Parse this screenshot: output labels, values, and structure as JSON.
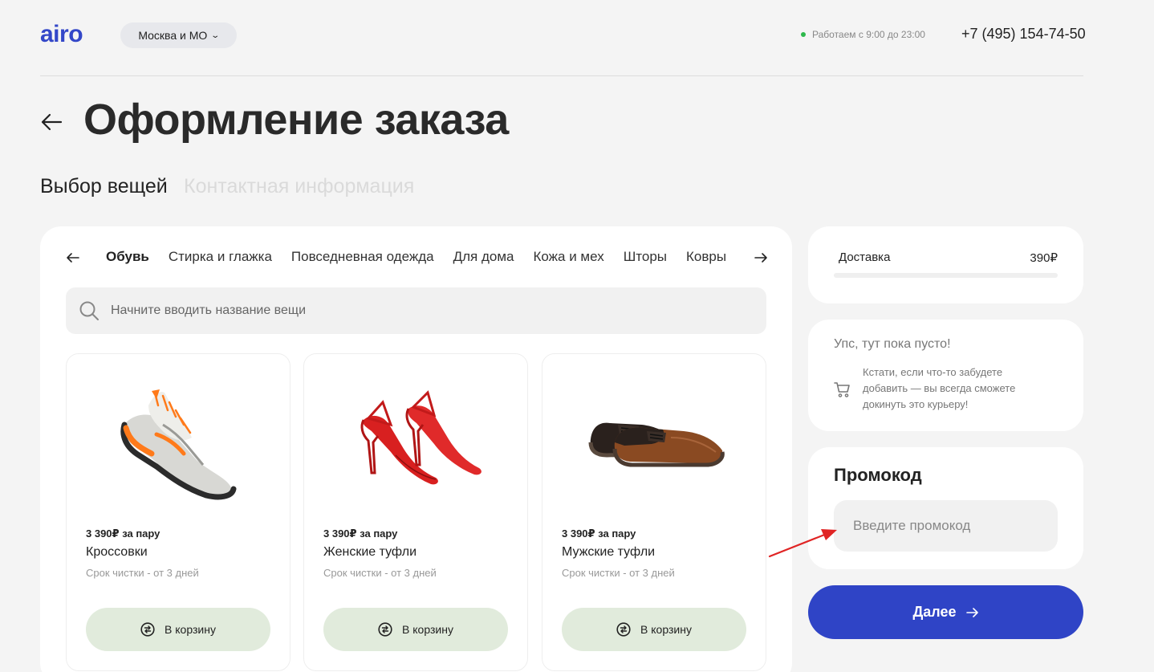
{
  "header": {
    "logo": "airo",
    "city": "Москва и МО",
    "hours": "Работаем с 9:00 до 23:00",
    "phone": "+7 (495) 154-74-50",
    "status_color": "#2db84b",
    "brand_color": "#3347c8"
  },
  "page": {
    "title": "Оформление заказа",
    "steps": [
      "Выбор вещей",
      "Контактная информация"
    ],
    "active_step": 0
  },
  "catalog": {
    "tabs": [
      "Обувь",
      "Стирка и глажка",
      "Повседневная одежда",
      "Для дома",
      "Кожа и мех",
      "Шторы",
      "Ковры"
    ],
    "active_tab": 0,
    "search_placeholder": "Начните вводить название вещи",
    "items": [
      {
        "price": "3 390₽ за пару",
        "name": "Кроссовки",
        "term": "Срок чистки - от 3 дней",
        "button": "В корзину",
        "image": "sneaker"
      },
      {
        "price": "3 390₽ за пару",
        "name": "Женские туфли",
        "term": "Срок чистки - от 3 дней",
        "button": "В корзину",
        "image": "red-heels"
      },
      {
        "price": "3 390₽ за пару",
        "name": "Мужские туфли",
        "term": "Срок чистки - от 3 дней",
        "button": "В корзину",
        "image": "men-oxfords"
      }
    ]
  },
  "sidebar": {
    "delivery_label": "Доставка",
    "delivery_value": "390₽",
    "empty_title": "Упс, тут пока пусто!",
    "empty_note": "Кстати, если что-то забудете добавить — вы всегда сможете докинуть это курьеру!",
    "promo_title": "Промокод",
    "promo_placeholder": "Введите промокод",
    "next_label": "Далее",
    "accent_color": "#2f44c6"
  },
  "annotation": {
    "color": "#e02424"
  }
}
